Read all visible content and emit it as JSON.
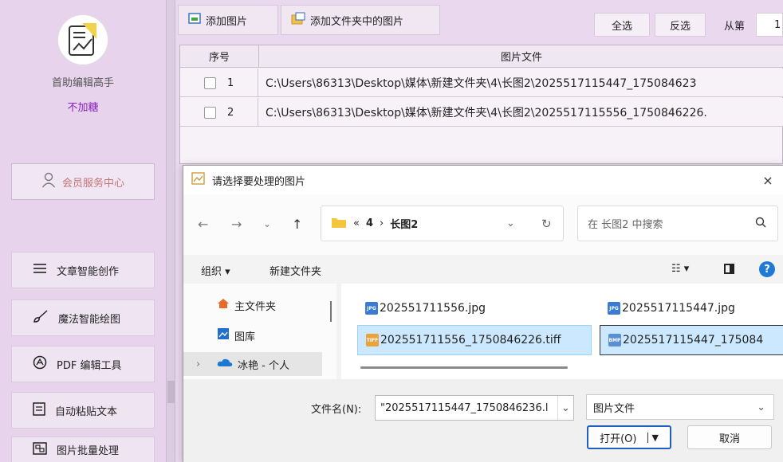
{
  "sidebar": {
    "app_name": "首助编辑高手",
    "app_tag": "不加糖",
    "member_label": "会员服务中心",
    "items": [
      {
        "label": "文章智能创作",
        "icon": "menu-lines-icon"
      },
      {
        "label": "魔法智能绘图",
        "icon": "brush-icon"
      },
      {
        "label": "PDF 编辑工具",
        "icon": "pdf-circle-icon"
      },
      {
        "label": "自动粘贴文本",
        "icon": "paste-icon"
      },
      {
        "label": "图片批量处理",
        "icon": "image-batch-icon"
      }
    ],
    "colors": {
      "accent": "#8a1fbf",
      "member_text": "#c47474"
    }
  },
  "toolbar": {
    "add_image": "添加图片",
    "add_folder_images": "添加文件夹中的图片",
    "select_all": "全选",
    "invert": "反选",
    "from_label": "从第",
    "from_value": "1"
  },
  "table": {
    "headers": [
      "序号",
      "图片文件"
    ],
    "rows": [
      {
        "num": "1",
        "path": "C:\\Users\\86313\\Desktop\\媒体\\新建文件夹\\4\\长图2\\2025517115447_175084623"
      },
      {
        "num": "2",
        "path": "C:\\Users\\86313\\Desktop\\媒体\\新建文件夹\\4\\长图2\\2025517115556_1750846226."
      }
    ]
  },
  "dialog": {
    "title": "请选择要处理的图片",
    "close": "×",
    "breadcrumb": {
      "prefix": "«",
      "parent": "4",
      "sep": "›",
      "current": "长图2"
    },
    "search_placeholder": "在 长图2 中搜索",
    "organize": "组织 ▾",
    "new_folder": "新建文件夹",
    "nav": [
      {
        "label": "主文件夹"
      },
      {
        "label": "图库"
      },
      {
        "label": "冰艳 - 个人"
      }
    ],
    "files": [
      {
        "name": "202551711556.jpg",
        "badge": "JPG"
      },
      {
        "name": "2025517115447.jpg",
        "badge": "JPG"
      },
      {
        "name": "202551711556_1750846226.tiff",
        "badge": "TIFF"
      },
      {
        "name": "2025517115447_175084",
        "badge": "BMP"
      }
    ],
    "filename_label": "文件名(N):",
    "filename_value": "\"2025517115447_1750846236.l",
    "filetype_value": "图片文件",
    "open_button": "打开(O)",
    "cancel_button": "取消"
  }
}
